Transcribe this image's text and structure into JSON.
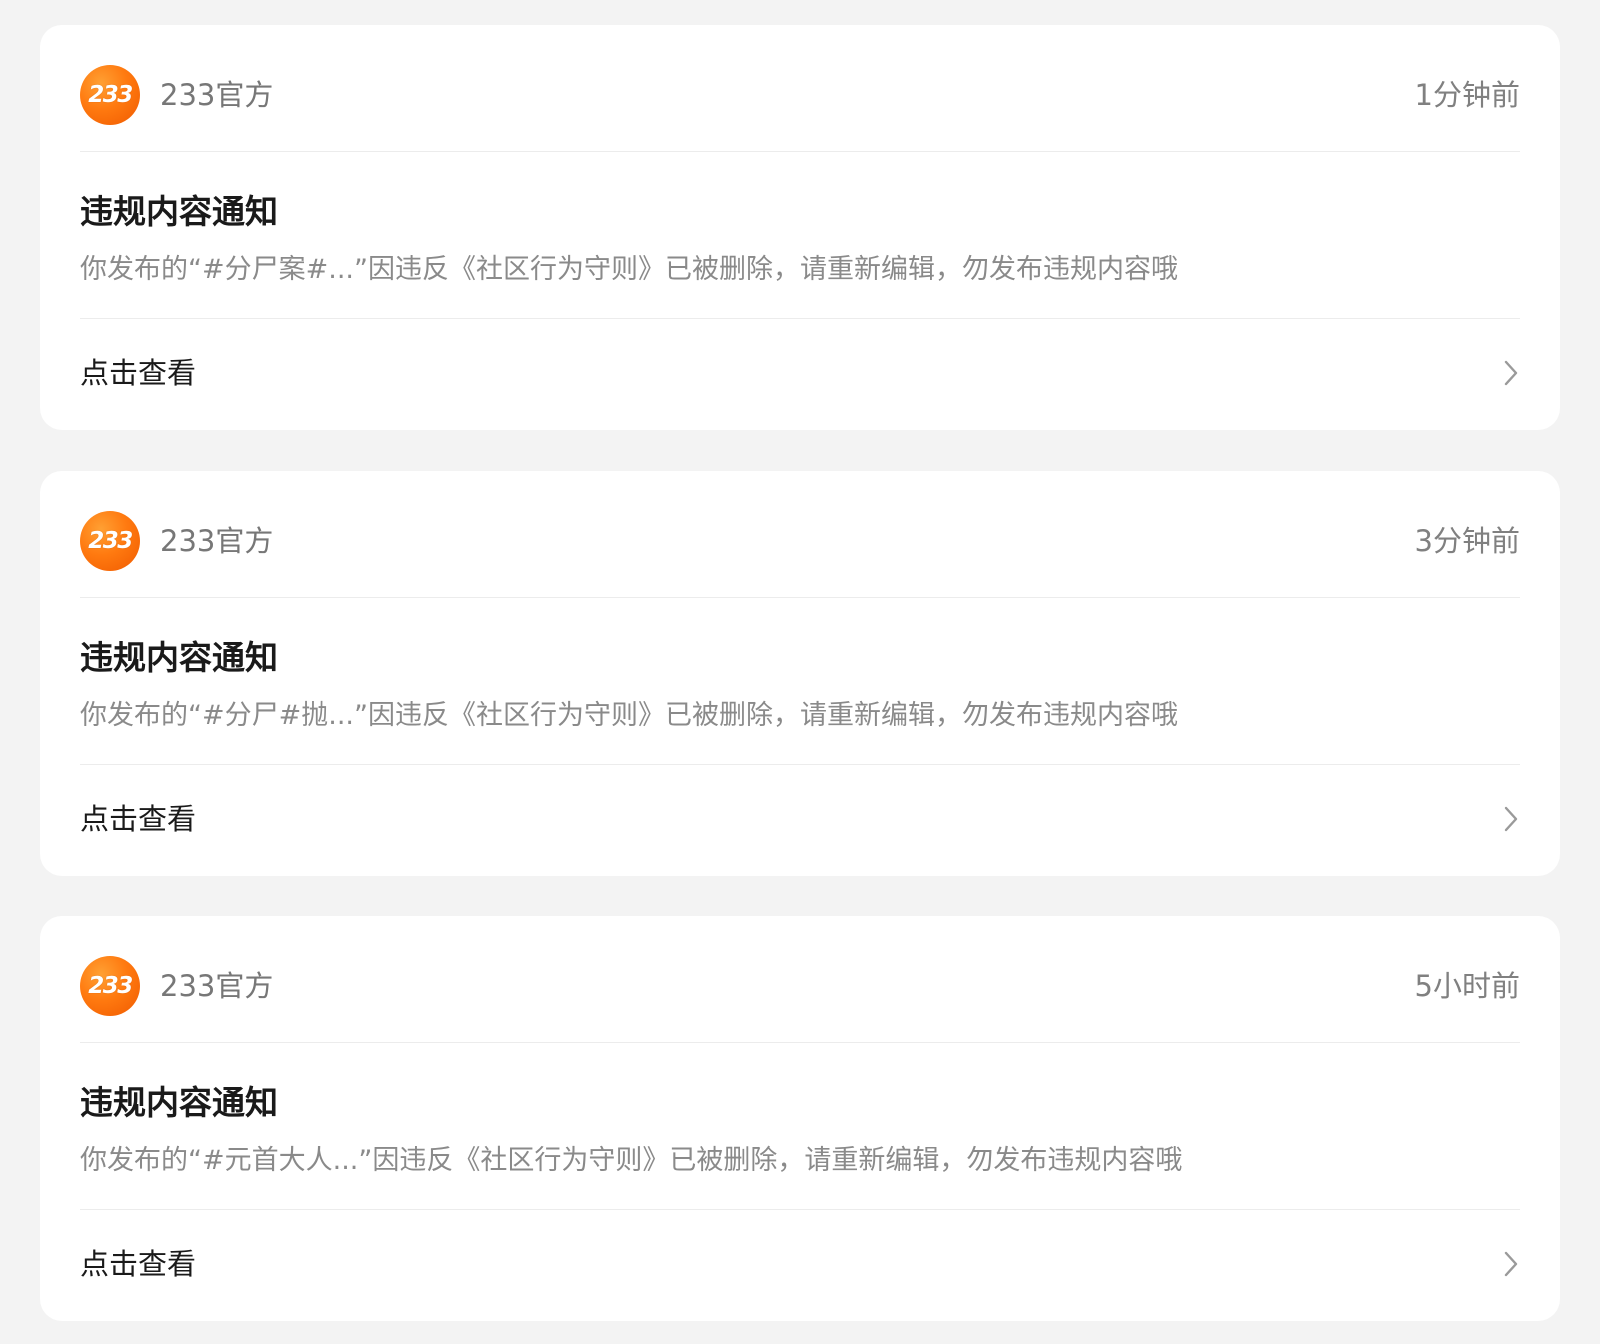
{
  "notifications": [
    {
      "avatar_text": "233",
      "sender": "233官方",
      "time": "1分钟前",
      "title": "违规内容通知",
      "description": "你发布的“#分尸案#...”因违反《社区行为守则》已被删除，请重新编辑，勿发布违规内容哦",
      "action_label": "点击查看"
    },
    {
      "avatar_text": "233",
      "sender": "233官方",
      "time": "3分钟前",
      "title": "违规内容通知",
      "description": "你发布的“#分尸#抛...”因违反《社区行为守则》已被删除，请重新编辑，勿发布违规内容哦",
      "action_label": "点击查看"
    },
    {
      "avatar_text": "233",
      "sender": "233官方",
      "time": "5小时前",
      "title": "违规内容通知",
      "description": "你发布的“#元首大人...”因违反《社区行为守则》已被删除，请重新编辑，勿发布违规内容哦",
      "action_label": "点击查看"
    }
  ],
  "icons": {
    "avatar": "233-logo-icon",
    "action": "chevron-right-icon"
  },
  "colors": {
    "background": "#f3f3f3",
    "card": "#ffffff",
    "avatar_orange": "#ff7a10",
    "title": "#1a1a1a",
    "secondary_text": "#8a8a8a"
  }
}
